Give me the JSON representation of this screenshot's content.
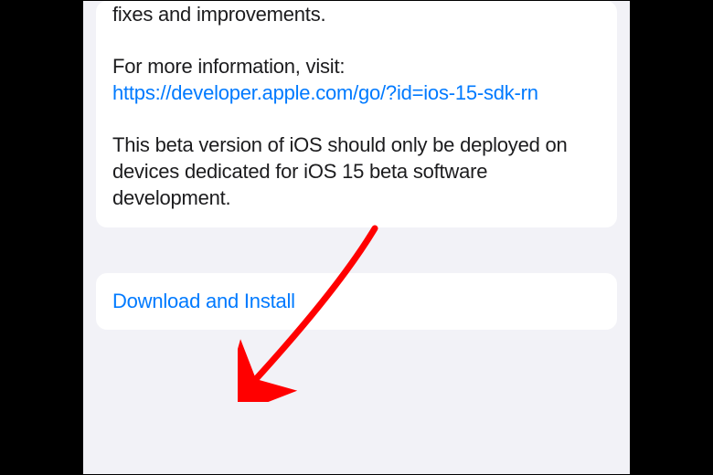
{
  "release_notes": {
    "partial_line": "fixes and improvements.",
    "info_prefix": "For more information, visit:",
    "info_url": "https://developer.apple.com/go/?id=ios-15-sdk-rn",
    "beta_warning": "This beta version of iOS should only be deployed on devices dedicated for iOS 15 beta software development."
  },
  "action": {
    "download_install_label": "Download and Install"
  },
  "annotation": {
    "arrow_color": "#ff0000"
  }
}
